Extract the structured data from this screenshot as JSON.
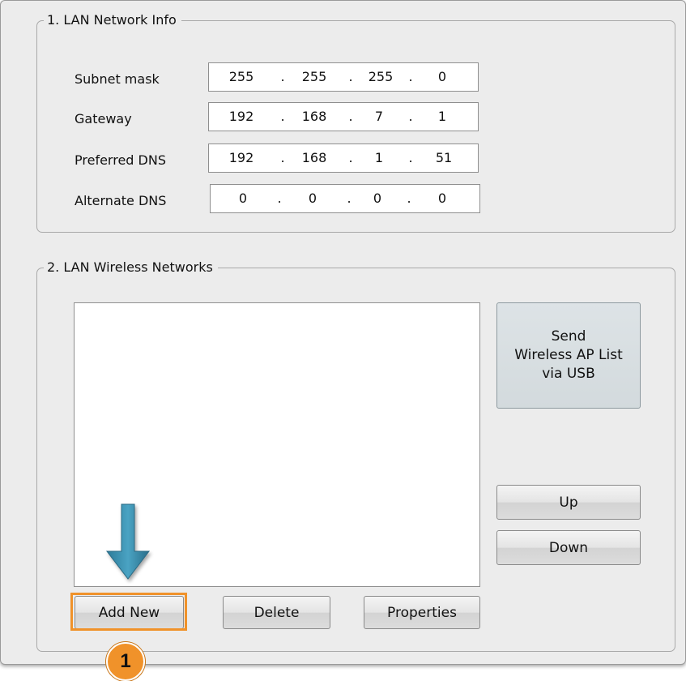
{
  "lan_info": {
    "title": "1. LAN Network Info",
    "rows": [
      {
        "label": "Subnet mask",
        "octets": [
          "255",
          "255",
          "255",
          "0"
        ]
      },
      {
        "label": "Gateway",
        "octets": [
          "192",
          "168",
          "7",
          "1"
        ]
      },
      {
        "label": "Preferred DNS",
        "octets": [
          "192",
          "168",
          "1",
          "51"
        ]
      },
      {
        "label": "Alternate DNS",
        "octets": [
          "0",
          "0",
          "0",
          "0"
        ]
      }
    ],
    "separator": "."
  },
  "wireless": {
    "title": "2. LAN Wireless Networks",
    "send_button": [
      "Send",
      "Wireless AP List",
      "via USB"
    ],
    "up_label": "Up",
    "down_label": "Down",
    "add_new_label": "Add New",
    "delete_label": "Delete",
    "properties_label": "Properties"
  },
  "callout": {
    "number": "1",
    "arrow_icon": "down-arrow-icon",
    "accent": "#f0922a",
    "arrow_color": "#3c8fae"
  }
}
